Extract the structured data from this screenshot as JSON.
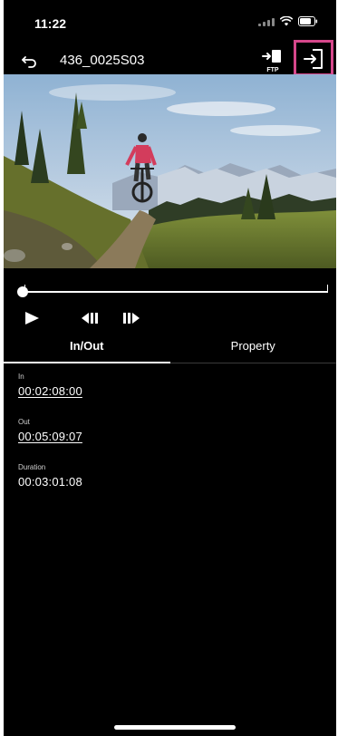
{
  "status_bar": {
    "time": "11:22"
  },
  "header": {
    "clip_name": "436_0025S03",
    "ftp_label": "FTP"
  },
  "tabs": [
    {
      "label": "In/Out",
      "active": true
    },
    {
      "label": "Property",
      "active": false
    }
  ],
  "in_out": {
    "in_label": "In",
    "in_value": "00:02:08:00",
    "out_label": "Out",
    "out_value": "00:05:09:07",
    "duration_label": "Duration",
    "duration_value": "00:03:01:08"
  },
  "playback": {
    "position_fraction": 0.0
  },
  "icons": {
    "back": "back-arrow-icon",
    "ftp": "ftp-transfer-icon",
    "exit": "exit-icon",
    "play": "play-icon",
    "step_back": "frame-back-icon",
    "step_forward": "frame-forward-icon"
  },
  "colors": {
    "highlight_border": "#d6478b",
    "background": "#000000",
    "text": "#ffffff"
  }
}
